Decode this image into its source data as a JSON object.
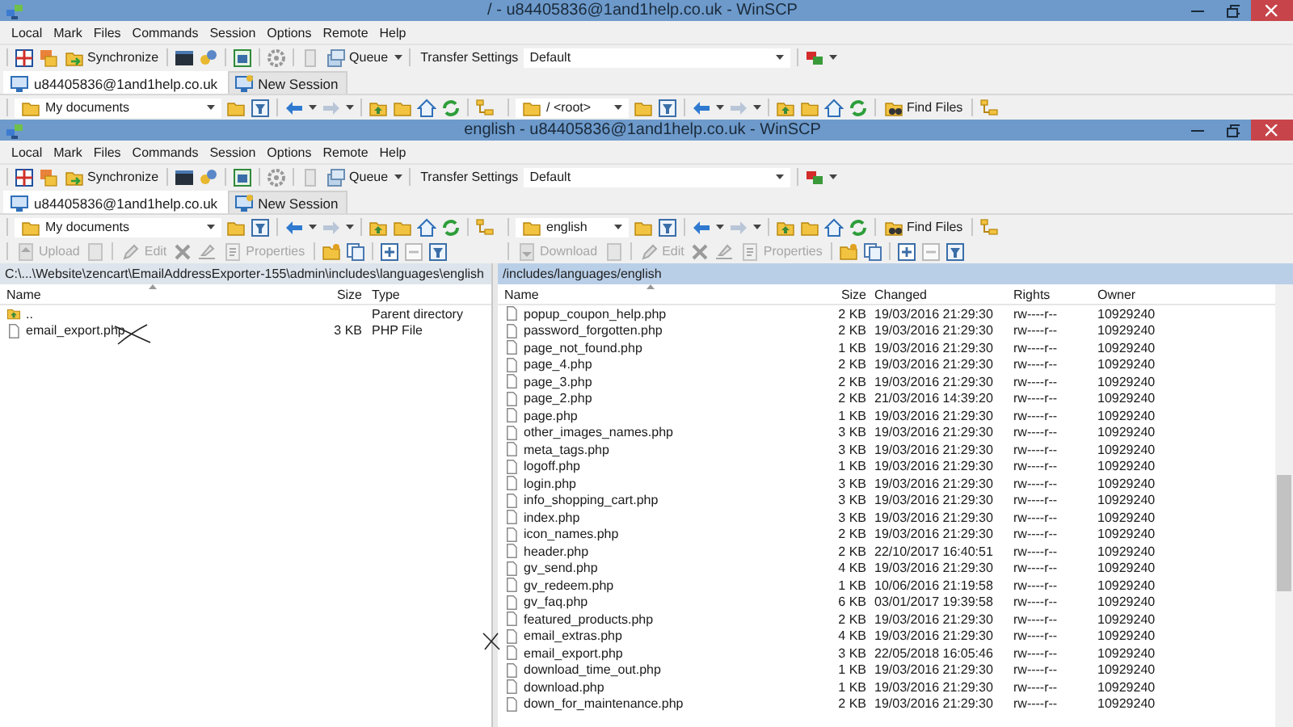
{
  "windows": [
    {
      "title": "/ - u84405836@1and1help.co.uk - WinSCP",
      "menu": [
        "Local",
        "Mark",
        "Files",
        "Commands",
        "Session",
        "Options",
        "Remote",
        "Help"
      ],
      "toolbar": {
        "synchronize": "Synchronize",
        "queue": "Queue",
        "transfer_label": "Transfer Settings",
        "transfer_preset": "Default"
      },
      "session_tabs": [
        {
          "kind": "session",
          "label": "u84405836@1and1help.co.uk",
          "selected": true
        },
        {
          "kind": "new",
          "label": "New Session",
          "selected": false
        }
      ],
      "local_location": "My documents",
      "remote_location": "/ <root>",
      "find_files": "Find Files"
    },
    {
      "title": "english - u84405836@1and1help.co.uk - WinSCP",
      "menu": [
        "Local",
        "Mark",
        "Files",
        "Commands",
        "Session",
        "Options",
        "Remote",
        "Help"
      ],
      "toolbar": {
        "synchronize": "Synchronize",
        "queue": "Queue",
        "transfer_label": "Transfer Settings",
        "transfer_preset": "Default"
      },
      "session_tabs": [
        {
          "kind": "session",
          "label": "u84405836@1and1help.co.uk",
          "selected": true
        },
        {
          "kind": "new",
          "label": "New Session",
          "selected": false
        }
      ],
      "local_location": "My documents",
      "remote_location": "english",
      "find_files": "Find Files",
      "local_actions": [
        {
          "label": "Upload",
          "disabled": true
        },
        {
          "label": "Edit",
          "disabled": true
        },
        {
          "label": "Properties",
          "disabled": true
        }
      ],
      "remote_actions": [
        {
          "label": "Download",
          "disabled": true
        },
        {
          "label": "Edit",
          "disabled": true
        },
        {
          "label": "Properties",
          "disabled": true
        }
      ],
      "local_panel": {
        "path": "C:\\...\\Website\\zencart\\EmailAddressExporter-155\\admin\\includes\\languages\\english",
        "active": false,
        "columns": [
          "Name",
          "Size",
          "Type"
        ],
        "rows": [
          {
            "kind": "parent",
            "name": "..",
            "type": "Parent directory"
          },
          {
            "kind": "file",
            "name": "email_export.php",
            "size": "3 KB",
            "type": "PHP File"
          }
        ]
      },
      "remote_panel": {
        "path": "/includes/languages/english",
        "active": true,
        "columns": [
          "Name",
          "Size",
          "Changed",
          "Rights",
          "Owner"
        ],
        "rows": [
          {
            "name": "popup_coupon_help.php",
            "size": "2 KB",
            "changed": "19/03/2016 21:29:30",
            "rights": "rw----r--",
            "owner": "10929240"
          },
          {
            "name": "password_forgotten.php",
            "size": "2 KB",
            "changed": "19/03/2016 21:29:30",
            "rights": "rw----r--",
            "owner": "10929240"
          },
          {
            "name": "page_not_found.php",
            "size": "1 KB",
            "changed": "19/03/2016 21:29:30",
            "rights": "rw----r--",
            "owner": "10929240"
          },
          {
            "name": "page_4.php",
            "size": "2 KB",
            "changed": "19/03/2016 21:29:30",
            "rights": "rw----r--",
            "owner": "10929240"
          },
          {
            "name": "page_3.php",
            "size": "2 KB",
            "changed": "19/03/2016 21:29:30",
            "rights": "rw----r--",
            "owner": "10929240"
          },
          {
            "name": "page_2.php",
            "size": "2 KB",
            "changed": "21/03/2016 14:39:20",
            "rights": "rw----r--",
            "owner": "10929240"
          },
          {
            "name": "page.php",
            "size": "1 KB",
            "changed": "19/03/2016 21:29:30",
            "rights": "rw----r--",
            "owner": "10929240"
          },
          {
            "name": "other_images_names.php",
            "size": "3 KB",
            "changed": "19/03/2016 21:29:30",
            "rights": "rw----r--",
            "owner": "10929240"
          },
          {
            "name": "meta_tags.php",
            "size": "3 KB",
            "changed": "19/03/2016 21:29:30",
            "rights": "rw----r--",
            "owner": "10929240"
          },
          {
            "name": "logoff.php",
            "size": "1 KB",
            "changed": "19/03/2016 21:29:30",
            "rights": "rw----r--",
            "owner": "10929240"
          },
          {
            "name": "login.php",
            "size": "3 KB",
            "changed": "19/03/2016 21:29:30",
            "rights": "rw----r--",
            "owner": "10929240"
          },
          {
            "name": "info_shopping_cart.php",
            "size": "3 KB",
            "changed": "19/03/2016 21:29:30",
            "rights": "rw----r--",
            "owner": "10929240"
          },
          {
            "name": "index.php",
            "size": "3 KB",
            "changed": "19/03/2016 21:29:30",
            "rights": "rw----r--",
            "owner": "10929240"
          },
          {
            "name": "icon_names.php",
            "size": "2 KB",
            "changed": "19/03/2016 21:29:30",
            "rights": "rw----r--",
            "owner": "10929240"
          },
          {
            "name": "header.php",
            "size": "2 KB",
            "changed": "22/10/2017 16:40:51",
            "rights": "rw----r--",
            "owner": "10929240"
          },
          {
            "name": "gv_send.php",
            "size": "4 KB",
            "changed": "19/03/2016 21:29:30",
            "rights": "rw----r--",
            "owner": "10929240"
          },
          {
            "name": "gv_redeem.php",
            "size": "1 KB",
            "changed": "10/06/2016 21:19:58",
            "rights": "rw----r--",
            "owner": "10929240"
          },
          {
            "name": "gv_faq.php",
            "size": "6 KB",
            "changed": "03/01/2017 19:39:58",
            "rights": "rw----r--",
            "owner": "10929240"
          },
          {
            "name": "featured_products.php",
            "size": "2 KB",
            "changed": "19/03/2016 21:29:30",
            "rights": "rw----r--",
            "owner": "10929240"
          },
          {
            "name": "email_extras.php",
            "size": "4 KB",
            "changed": "19/03/2016 21:29:30",
            "rights": "rw----r--",
            "owner": "10929240"
          },
          {
            "name": "email_export.php",
            "size": "3 KB",
            "changed": "22/05/2018 16:05:46",
            "rights": "rw----r--",
            "owner": "10929240"
          },
          {
            "name": "download_time_out.php",
            "size": "1 KB",
            "changed": "19/03/2016 21:29:30",
            "rights": "rw----r--",
            "owner": "10929240"
          },
          {
            "name": "download.php",
            "size": "1 KB",
            "changed": "19/03/2016 21:29:30",
            "rights": "rw----r--",
            "owner": "10929240"
          },
          {
            "name": "down_for_maintenance.php",
            "size": "2 KB",
            "changed": "19/03/2016 21:29:30",
            "rights": "rw----r--",
            "owner": "10929240"
          }
        ]
      }
    }
  ]
}
